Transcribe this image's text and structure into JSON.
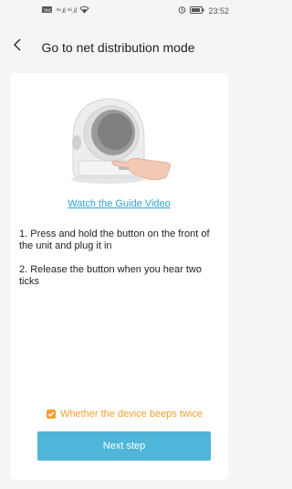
{
  "status_bar": {
    "signal_left": "⁴⁶.ıl ⁴⁶.ıl",
    "right_text": "23:52"
  },
  "nav": {
    "title": "Go to net distribution mode"
  },
  "card": {
    "guide_link": "Watch the Guide Video",
    "steps": [
      "1. Press and hold the button on the front of the unit and plug it in",
      "2. Release the button when you hear two ticks"
    ],
    "beep_checkbox_label": "Whether the device beeps twice",
    "beep_checked": true,
    "next_button": "Next step"
  },
  "colors": {
    "link": "#2ba3d6",
    "accent_orange": "#f0a02e",
    "button": "#4fb5d9",
    "background": "#f5f5f5"
  }
}
